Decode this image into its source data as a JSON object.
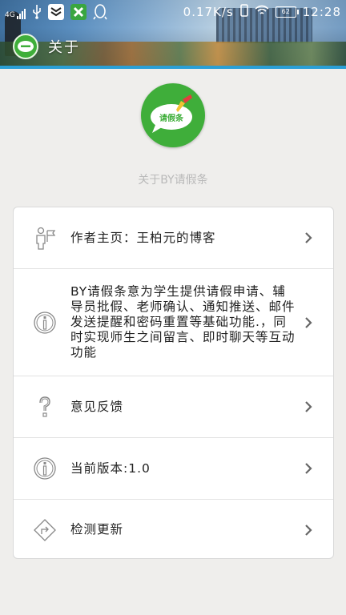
{
  "status_bar": {
    "network_type": "4G",
    "net_speed": "0.17K/s",
    "battery": "62",
    "time": "12:28",
    "icons": [
      "signal-icon",
      "usb-icon",
      "shield-app-icon",
      "green-x-app-icon",
      "qq-icon",
      "phone-icon",
      "wifi-icon",
      "battery-icon"
    ]
  },
  "appbar": {
    "title": "关于"
  },
  "about": {
    "app_name_title": "关于BY请假条",
    "logo_text": "请假条"
  },
  "menu": {
    "items": [
      {
        "label": "作者主页：王柏元的博客",
        "icon": "author-icon"
      },
      {
        "label": "BY请假条意为学生提供请假申请、辅导员批假、老师确认、通知推送、邮件发送提醒和密码重置等基础功能.，同时实现师生之间留言、即时聊天等互动功能",
        "icon": "info-icon"
      },
      {
        "label": "意见反馈",
        "icon": "question-icon"
      },
      {
        "label": "当前版本:1.0",
        "icon": "info-icon"
      },
      {
        "label": "检测更新",
        "icon": "update-icon"
      }
    ]
  },
  "colors": {
    "accent": "#2a9fd6",
    "logo_green": "#3fae3a",
    "background": "#efeeec"
  }
}
